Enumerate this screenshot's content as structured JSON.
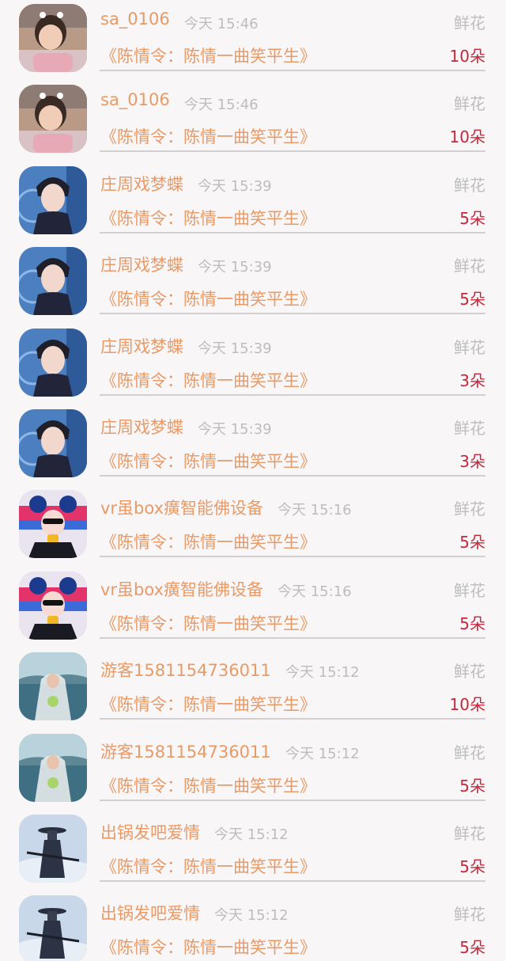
{
  "list": {
    "rows": [
      {
        "user": "sa_0106",
        "time": "今天 15:46",
        "gift": "鲜花",
        "work": "《陈情令：陈情一曲笑平生》",
        "amount": "10朵",
        "avatar": "girl-avatar-icon"
      },
      {
        "user": "sa_0106",
        "time": "今天 15:46",
        "gift": "鲜花",
        "work": "《陈情令：陈情一曲笑平生》",
        "amount": "10朵",
        "avatar": "girl-avatar-icon"
      },
      {
        "user": "庄周戏梦蝶",
        "time": "今天 15:39",
        "gift": "鲜花",
        "work": "《陈情令：陈情一曲笑平生》",
        "amount": "5朵",
        "avatar": "young-man-avatar-icon"
      },
      {
        "user": "庄周戏梦蝶",
        "time": "今天 15:39",
        "gift": "鲜花",
        "work": "《陈情令：陈情一曲笑平生》",
        "amount": "5朵",
        "avatar": "young-man-avatar-icon"
      },
      {
        "user": "庄周戏梦蝶",
        "time": "今天 15:39",
        "gift": "鲜花",
        "work": "《陈情令：陈情一曲笑平生》",
        "amount": "3朵",
        "avatar": "young-man-avatar-icon"
      },
      {
        "user": "庄周戏梦蝶",
        "time": "今天 15:39",
        "gift": "鲜花",
        "work": "《陈情令：陈情一曲笑平生》",
        "amount": "3朵",
        "avatar": "young-man-avatar-icon"
      },
      {
        "user": "vr虽box癀智能佛设备",
        "time": "今天 15:16",
        "gift": "鲜花",
        "work": "《陈情令：陈情一曲笑平生》",
        "amount": "5朵",
        "avatar": "cartoon-girl-avatar-icon"
      },
      {
        "user": "vr虽box癀智能佛设备",
        "time": "今天 15:16",
        "gift": "鲜花",
        "work": "《陈情令：陈情一曲笑平生》",
        "amount": "5朵",
        "avatar": "cartoon-girl-avatar-icon"
      },
      {
        "user": "游客1581154736011",
        "time": "今天 15:12",
        "gift": "鲜花",
        "work": "《陈情令：陈情一曲笑平生》",
        "amount": "10朵",
        "avatar": "bride-avatar-icon"
      },
      {
        "user": "游客1581154736011",
        "time": "今天 15:12",
        "gift": "鲜花",
        "work": "《陈情令：陈情一曲笑平生》",
        "amount": "5朵",
        "avatar": "bride-avatar-icon"
      },
      {
        "user": "出锅发吧爱情",
        "time": "今天 15:12",
        "gift": "鲜花",
        "work": "《陈情令：陈情一曲笑平生》",
        "amount": "5朵",
        "avatar": "swordsman-avatar-icon"
      },
      {
        "user": "出锅发吧爱情",
        "time": "今天 15:12",
        "gift": "鲜花",
        "work": "《陈情令：陈情一曲笑平生》",
        "amount": "5朵",
        "avatar": "swordsman-avatar-icon"
      }
    ]
  },
  "colors": {
    "username": "#e89a67",
    "title": "#e89a67",
    "meta": "#bdbdbd",
    "amount": "#c5283d",
    "background": "#f8f6f7"
  }
}
